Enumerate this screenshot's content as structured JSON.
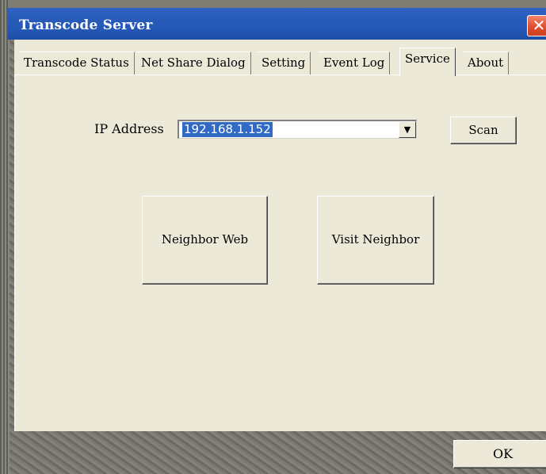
{
  "window": {
    "title": "Transcode Server",
    "close_glyph": "✕"
  },
  "tabs": [
    {
      "label": "Transcode Status",
      "active": false
    },
    {
      "label": "Net Share Dialog",
      "active": false
    },
    {
      "label": "Setting",
      "active": false
    },
    {
      "label": "Event Log",
      "active": false
    },
    {
      "label": "Service",
      "active": true
    },
    {
      "label": "About",
      "active": false
    }
  ],
  "service": {
    "ip_label": "IP Address",
    "ip_value": "192.168.1.152",
    "dropdown_glyph": "▼",
    "scan_label": "Scan",
    "neighbor_web_label": "Neighbor Web",
    "visit_neighbor_label": "Visit Neighbor"
  },
  "dialog": {
    "ok_label": "OK"
  },
  "icons": {
    "close": "close-icon",
    "dropdown": "chevron-down-icon"
  },
  "colors": {
    "titlebar": "#2457b7",
    "panel": "#ece9d8",
    "selection": "#316ac5",
    "close_button": "#dd4b2a"
  }
}
